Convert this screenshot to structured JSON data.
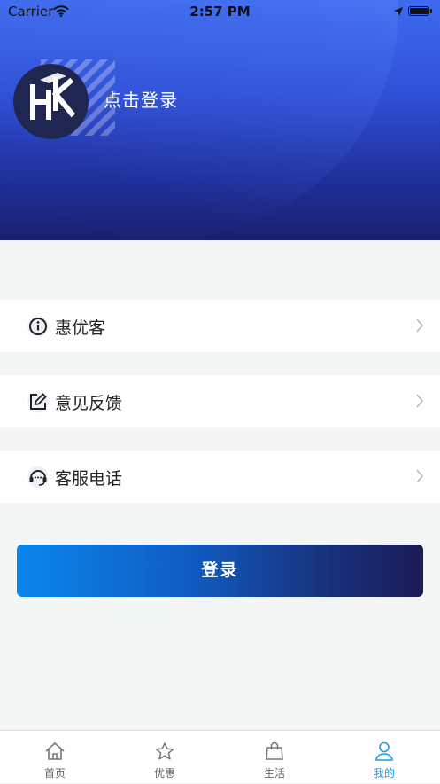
{
  "status_bar": {
    "carrier": "Carrier",
    "time": "2:57 PM"
  },
  "profile": {
    "login_prompt": "点击登录"
  },
  "menu": [
    {
      "label": "惠优客",
      "icon": "info-circle-icon"
    },
    {
      "label": "意见反馈",
      "icon": "edit-icon"
    },
    {
      "label": "客服电话",
      "icon": "headset-icon"
    }
  ],
  "login_button": {
    "label": "登录"
  },
  "tabs": [
    {
      "label": "首页",
      "icon": "home-icon",
      "active": false
    },
    {
      "label": "优惠",
      "icon": "star-icon",
      "active": false
    },
    {
      "label": "生活",
      "icon": "shopping-bag-icon",
      "active": false
    },
    {
      "label": "我的",
      "icon": "user-icon",
      "active": true
    }
  ],
  "colors": {
    "accent": "#1e9be6",
    "header_dark": "#1a1f6e",
    "header_light": "#3e6bf0"
  }
}
